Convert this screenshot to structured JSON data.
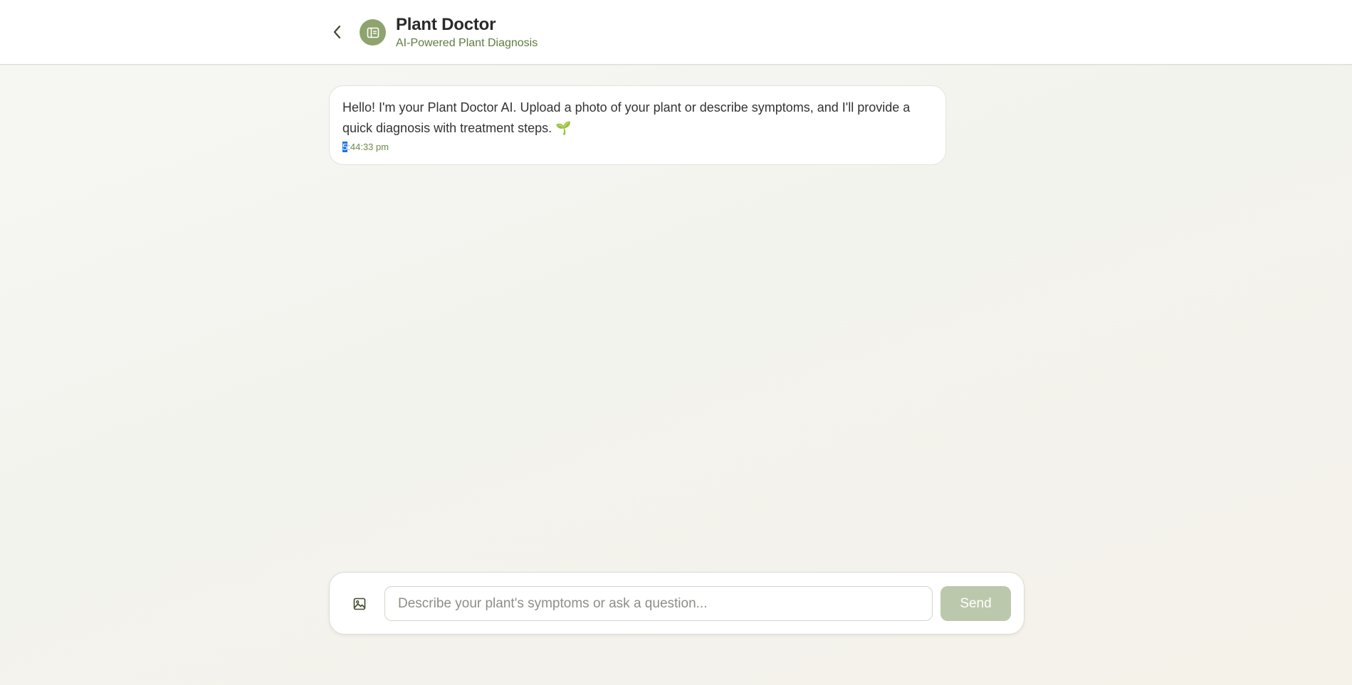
{
  "header": {
    "title": "Plant Doctor",
    "subtitle": "AI-Powered Plant Diagnosis",
    "back_icon": "chevron-left-icon",
    "avatar_icon": "document-icon"
  },
  "messages": [
    {
      "sender": "assistant",
      "text": "Hello! I'm your Plant Doctor AI. Upload a photo of your plant or describe symptoms, and I'll provide a quick diagnosis with treatment steps. 🌱",
      "time_selected": "5",
      "time_rest": ":44:33 pm"
    }
  ],
  "composer": {
    "image_icon": "image-icon",
    "input_value": "",
    "input_placeholder": "Describe your plant's symptoms or ask a question...",
    "send_label": "Send"
  },
  "colors": {
    "accent": "#8fa36f",
    "subtitle": "#5f7a3f",
    "send_disabled": "#bcc8ac"
  }
}
